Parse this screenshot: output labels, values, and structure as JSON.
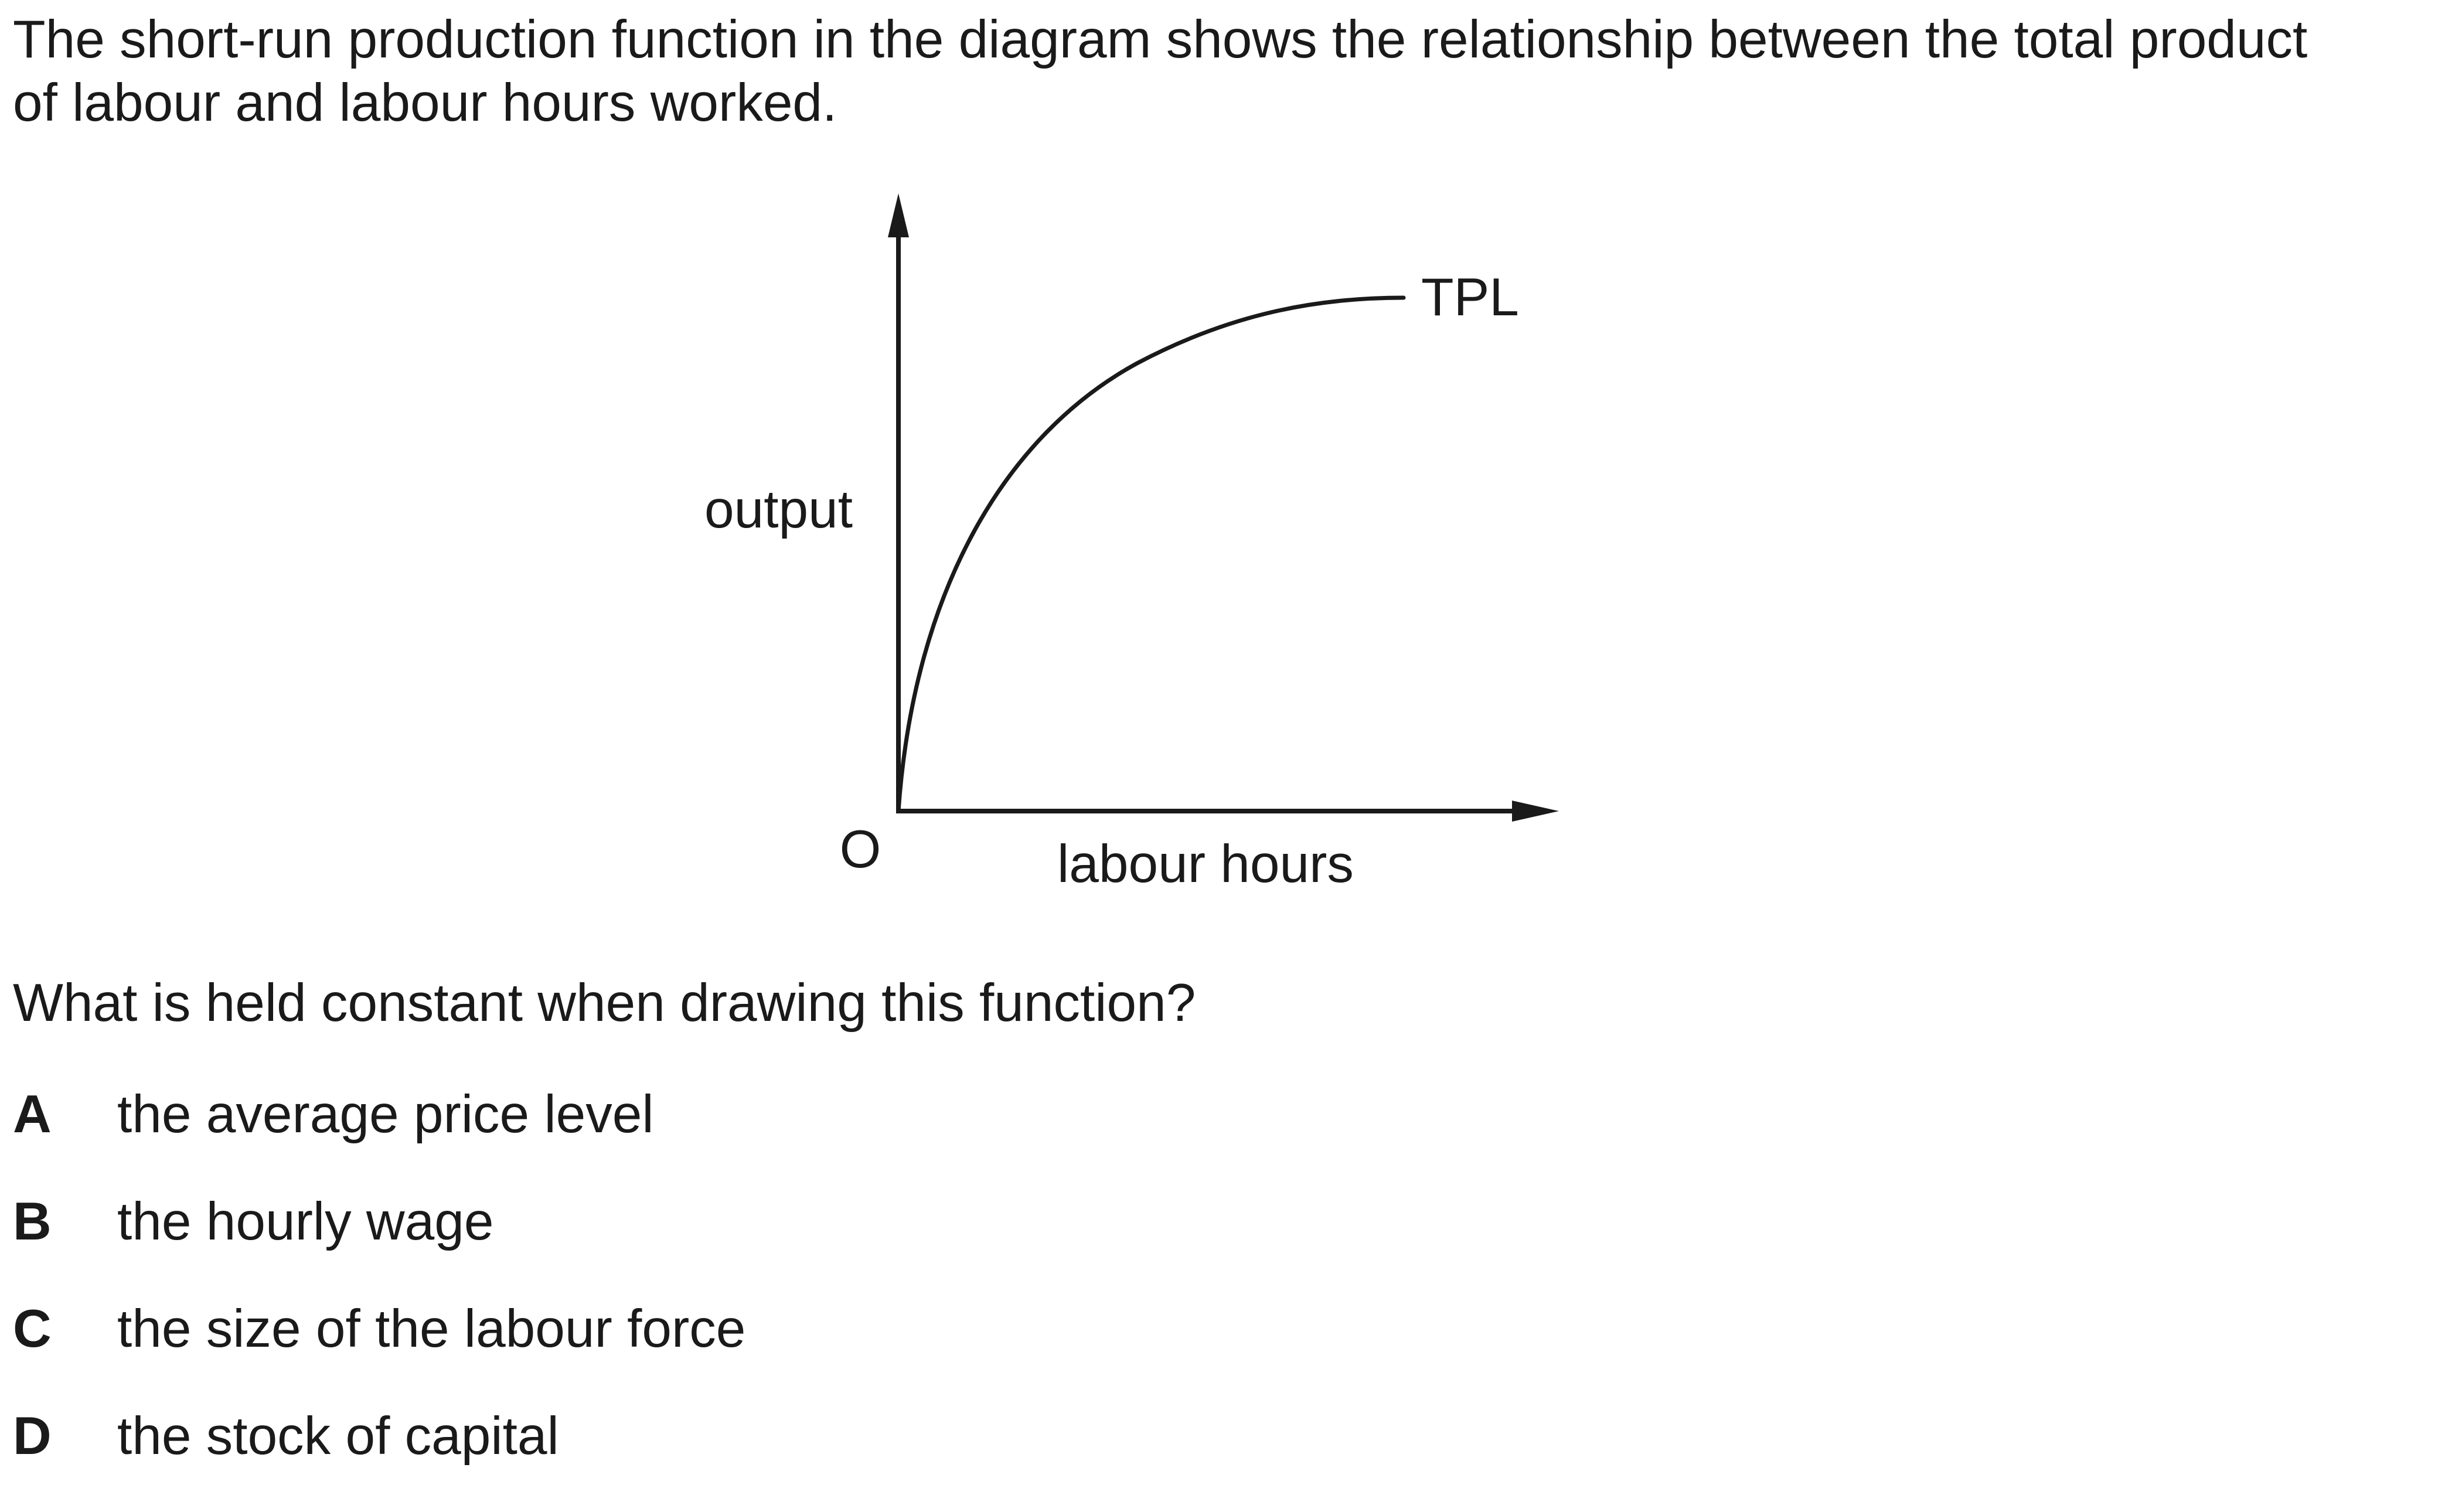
{
  "intro": {
    "line1": "The short-run production function in the diagram shows the relationship between the total product",
    "line2": "of labour and labour hours worked."
  },
  "diagram": {
    "curve_label": "TPL",
    "y_axis_label": "output",
    "x_axis_label": "labour hours",
    "origin_label": "O",
    "line_color": "#1a1a1a"
  },
  "question": "What is held constant when drawing this function?",
  "options": [
    {
      "letter": "A",
      "text": "the average price level"
    },
    {
      "letter": "B",
      "text": "the hourly wage"
    },
    {
      "letter": "C",
      "text": "the size of the labour force"
    },
    {
      "letter": "D",
      "text": "the stock of capital"
    }
  ]
}
